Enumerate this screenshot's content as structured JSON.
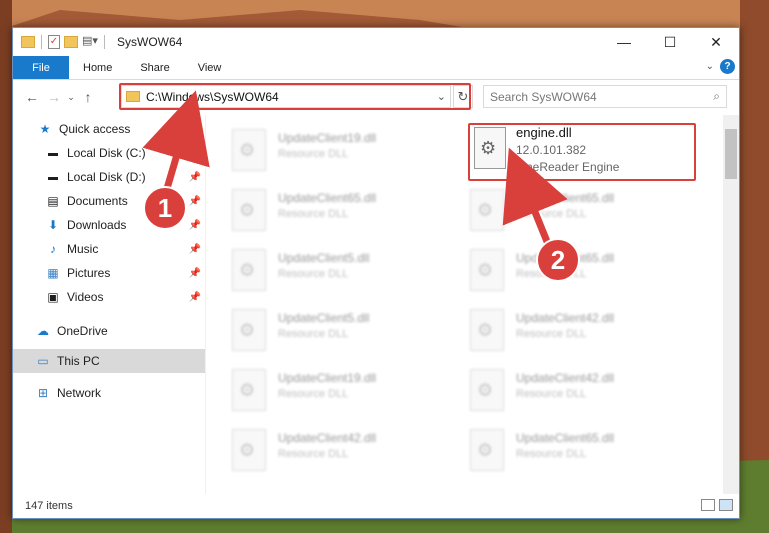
{
  "window": {
    "title": "SysWOW64",
    "controls": {
      "minimize": "—",
      "maximize": "☐",
      "close": "✕"
    }
  },
  "ribbon": {
    "tabs": [
      "File",
      "Home",
      "Share",
      "View"
    ],
    "help": "?"
  },
  "address": {
    "path": "C:\\Windows\\SysWOW64",
    "search_placeholder": "Search SysWOW64"
  },
  "nav": {
    "quick_access": "Quick access",
    "items": [
      {
        "label": "Local Disk (C:)",
        "icon": "drive-icon",
        "pinned": true
      },
      {
        "label": "Local Disk (D:)",
        "icon": "drive-icon",
        "pinned": true
      },
      {
        "label": "Documents",
        "icon": "documents-icon",
        "pinned": true
      },
      {
        "label": "Downloads",
        "icon": "download-icon",
        "pinned": true
      },
      {
        "label": "Music",
        "icon": "music-icon",
        "pinned": true
      },
      {
        "label": "Pictures",
        "icon": "pictures-icon",
        "pinned": true
      },
      {
        "label": "Videos",
        "icon": "videos-icon",
        "pinned": true
      }
    ],
    "onedrive": "OneDrive",
    "this_pc": "This PC",
    "network": "Network"
  },
  "files": {
    "left_column": [
      {
        "name": "UpdateClient19.dll",
        "type": "Resource DLL"
      },
      {
        "name": "UpdateClient65.dll",
        "type": "Resource DLL"
      },
      {
        "name": "UpdateClient5.dll",
        "type": "Resource DLL"
      },
      {
        "name": "UpdateClient5.dll",
        "type": "Resource DLL"
      },
      {
        "name": "UpdateClient19.dll",
        "type": "Resource DLL"
      },
      {
        "name": "UpdateClient42.dll",
        "type": "Resource DLL"
      }
    ],
    "right_column": [
      {
        "name": "UpdateClient65.dll",
        "type": "Resource DLL"
      },
      {
        "name": "UpdateClient65.dll",
        "type": "Resource DLL"
      },
      {
        "name": "UpdateClient42.dll",
        "type": "Resource DLL"
      },
      {
        "name": "UpdateClient42.dll",
        "type": "Resource DLL"
      },
      {
        "name": "UpdateClient65.dll",
        "type": "Resource DLL"
      }
    ],
    "highlighted": {
      "name": "engine.dll",
      "version": "12.0.101.382",
      "description": "FineReader Engine"
    }
  },
  "status": {
    "item_count": "147 items"
  },
  "callouts": {
    "one": "1",
    "two": "2"
  },
  "colors": {
    "accent": "#1979ca",
    "highlight": "#d9403b"
  }
}
